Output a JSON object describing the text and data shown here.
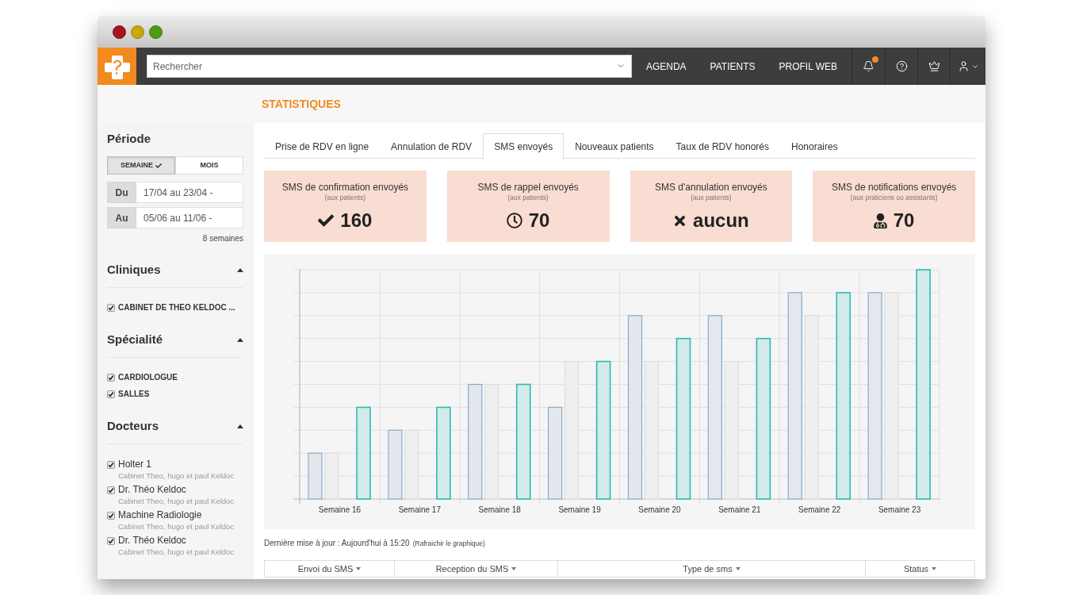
{
  "nav": {
    "search": {
      "placeholder": "Rechercher"
    },
    "links": [
      "AGENDA",
      "PATIENTS",
      "PROFIL WEB"
    ],
    "notifications": {
      "unread": true
    }
  },
  "page_title": "STATISTIQUES",
  "sidebar": {
    "period": {
      "title": "Période",
      "options": [
        {
          "label": "SEMAINE",
          "selected": true
        },
        {
          "label": "MOIS",
          "selected": false
        }
      ],
      "from": {
        "label": "Du",
        "value": "17/04 au 23/04 -"
      },
      "to": {
        "label": "Au",
        "value": "05/06 au 11/06 -"
      },
      "summary": "8 semaines"
    },
    "filters": [
      {
        "title": "Cliniques",
        "kind": "category",
        "expanded": true,
        "items": [
          {
            "label": "CABINET DE THEO KELDOC ...",
            "checked": true
          }
        ]
      },
      {
        "title": "Spécialité",
        "kind": "category",
        "expanded": true,
        "items": [
          {
            "label": "CARDIOLOGUE",
            "checked": true
          },
          {
            "label": "SALLES",
            "checked": true
          }
        ]
      },
      {
        "title": "Docteurs",
        "kind": "person",
        "expanded": true,
        "items": [
          {
            "label": "Holter 1",
            "detail": "Cabinet Theo, hugo et paul Keldoc",
            "checked": true
          },
          {
            "label": "Dr. Théo Keldoc",
            "detail": "Cabinet Theo, hugo et paul Keldoc",
            "checked": true
          },
          {
            "label": "Machine Radiologie",
            "detail": "Cabinet Theo, hugo et paul Keldoc",
            "checked": true
          },
          {
            "label": "Dr. Théo Keldoc",
            "detail": "Cabinet Theo, hugo et paul Keldoc",
            "checked": true
          }
        ]
      }
    ]
  },
  "tabs": [
    {
      "label": "Prise de RDV en ligne",
      "selected": false
    },
    {
      "label": "Annulation de RDV",
      "selected": false
    },
    {
      "label": "SMS envoyés",
      "selected": true
    },
    {
      "label": "Nouveaux patients",
      "selected": false
    },
    {
      "label": "Taux de RDV honorés",
      "selected": false
    },
    {
      "label": "Honoraires",
      "selected": false
    }
  ],
  "stat_cards": [
    {
      "kind": "confirmation",
      "title": "SMS de confirmation envoyés",
      "audience": "(aux patients)",
      "value": "160"
    },
    {
      "kind": "reminder",
      "title": "SMS de rappel envoyés",
      "audience": "(aux patients)",
      "value": "70"
    },
    {
      "kind": "cancellation",
      "title": "SMS d'annulation envoyés",
      "audience": "(aux patients)",
      "value": "aucun"
    },
    {
      "kind": "notification",
      "title": "SMS de notifications envoyés",
      "audience": "(aux praticiens ou assistants)",
      "value": "70"
    }
  ],
  "chart": {
    "x_labels": [
      "Semaine 16",
      "Semaine 17",
      "Semaine 18",
      "Semaine 19",
      "Semaine 20",
      "Semaine 21",
      "Semaine 22",
      "Semaine 23"
    ]
  },
  "last_update": {
    "text": "Dernière mise à jour : Aujourd'hui à 15:20",
    "link": "(Rafraichir le graphique)"
  },
  "table": {
    "columns": [
      "Envoi du SMS",
      "Reception du SMS",
      "Type de sms",
      "Status"
    ]
  }
}
